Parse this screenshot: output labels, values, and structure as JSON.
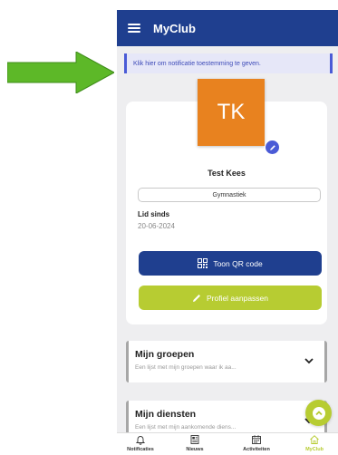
{
  "app": {
    "title": "MyClub"
  },
  "notification_banner": {
    "text": "Klik hier om notificatie toestemming te geven."
  },
  "profile": {
    "initials": "TK",
    "name": "Test Kees",
    "activity": "Gymnastiek",
    "member_since_label": "Lid sinds",
    "member_since_date": "20-06-2024",
    "qr_button_label": "Toon QR code",
    "edit_button_label": "Profiel aanpassen"
  },
  "sections": [
    {
      "title": "Mijn groepen",
      "subtitle": "Een lijst met mijn groepen waar ik aa..."
    },
    {
      "title": "Mijn diensten",
      "subtitle": "Een lijst met mijn aankomende diens..."
    }
  ],
  "bottom_nav": [
    {
      "label": "Notificaties",
      "icon": "bell-icon"
    },
    {
      "label": "Nieuws",
      "icon": "newspaper-icon"
    },
    {
      "label": "Activiteiten",
      "icon": "calendar-icon"
    },
    {
      "label": "MyClub",
      "icon": "home-icon",
      "active": true
    }
  ],
  "colors": {
    "primary": "#1f3f8f",
    "accent": "#b7cc32",
    "avatar": "#e8821f",
    "banner": "#e6e7f8",
    "annotation_arrow": "#5db828"
  }
}
